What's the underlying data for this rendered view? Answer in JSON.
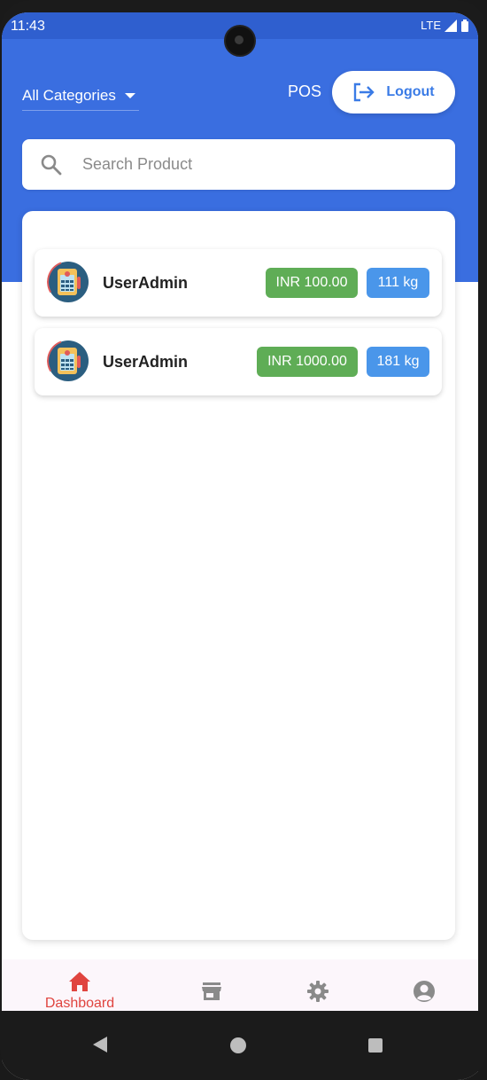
{
  "status_bar": {
    "time": "11:43",
    "network": "LTE"
  },
  "header": {
    "category_select": "All Categories",
    "pos_label": "POS",
    "logout_label": "Logout"
  },
  "search": {
    "placeholder": "Search Product"
  },
  "products": [
    {
      "name": "UserAdmin",
      "price": "INR 100.00",
      "weight": "111 kg"
    },
    {
      "name": "UserAdmin",
      "price": "INR 1000.00",
      "weight": "181 kg"
    }
  ],
  "bottom_nav": {
    "items": [
      {
        "label": "Dashboard",
        "icon": "home-icon",
        "active": true
      },
      {
        "label": "",
        "icon": "store-icon",
        "active": false
      },
      {
        "label": "",
        "icon": "settings-gear-icon",
        "active": false
      },
      {
        "label": "",
        "icon": "account-icon",
        "active": false
      }
    ]
  },
  "colors": {
    "primary": "#3a6ee0",
    "status_bar": "#2f5fcf",
    "price_badge": "#5fad56",
    "weight_badge": "#4a96ea",
    "active_nav": "#e0443f",
    "inactive_nav": "#8a8a8a"
  }
}
